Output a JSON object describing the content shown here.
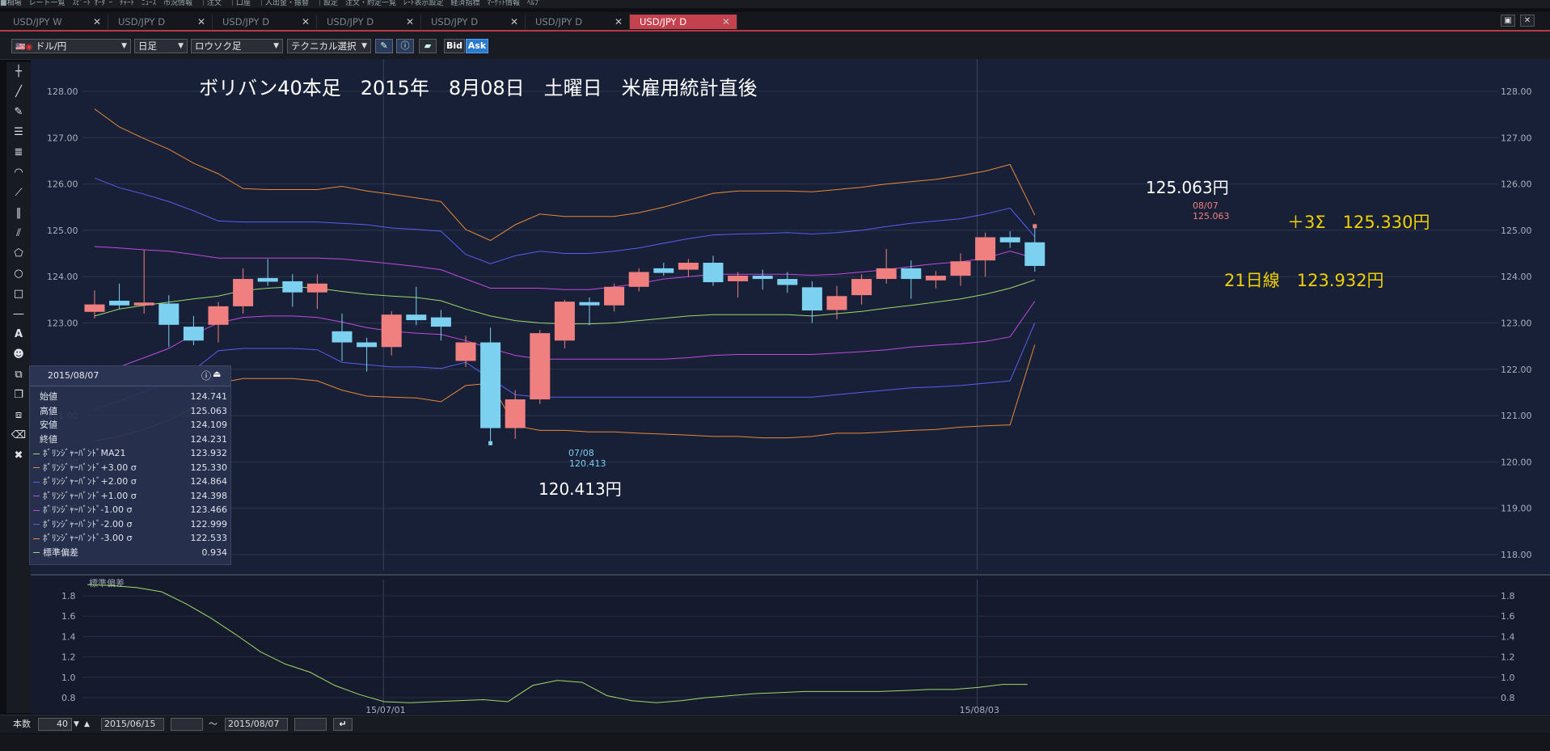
{
  "menubar": {
    "text": "■相場　レート一覧　ｽﾋﾟｰﾄﾞｵｰﾀﾞｰ　ﾁｬｰﾄ　ﾆｭｰｽ　市況情報　｜注文　｜口座　｜入出金・振替　｜設定　注文・約定一覧　ﾚｰﾄ表示設定　経済指標　ﾏｰｹｯﾄ情報　ﾍﾙﾌﾟ"
  },
  "tabs": [
    {
      "label": "USD/JPY W",
      "active": false
    },
    {
      "label": "USD/JPY D",
      "active": false
    },
    {
      "label": "USD/JPY D",
      "active": false
    },
    {
      "label": "USD/JPY D",
      "active": false
    },
    {
      "label": "USD/JPY D",
      "active": false
    },
    {
      "label": "USD/JPY D",
      "active": false
    },
    {
      "label": "USD/JPY D",
      "active": true
    }
  ],
  "toolbar": {
    "pair": "ドル/円",
    "period": "日足",
    "chart_type": "ロウソク足",
    "technical": "テクニカル選択",
    "bid": "Bid",
    "ask": "Ask"
  },
  "tools": [
    "crosshair",
    "line",
    "ruler",
    "hlines",
    "channels",
    "arc",
    "fan",
    "vlines",
    "gann",
    "pentagon",
    "circle",
    "rect",
    "dash",
    "text",
    "label",
    "copy-a",
    "copy-b",
    "copy-c",
    "eraser",
    "eraser-b"
  ],
  "annotations": {
    "title": "ボリバン40本足　2015年　8月08日　土曜日　米雇用統計直後",
    "high_label": "125.063円",
    "high_tag_date": "08/07",
    "high_tag_value": "125.063",
    "plus3sigma": "＋3Σ　125.330円",
    "ma21": "21日線　123.932円",
    "low_label": "120.413円",
    "low_tag_date": "07/08",
    "low_tag_value": "120.413"
  },
  "info_panel": {
    "date": "2015/08/07",
    "rows": [
      {
        "label": "始値",
        "value": "124.741",
        "color": ""
      },
      {
        "label": "高値",
        "value": "125.063",
        "color": ""
      },
      {
        "label": "安値",
        "value": "124.109",
        "color": ""
      },
      {
        "label": "終値",
        "value": "124.231",
        "color": ""
      },
      {
        "label": "ﾎﾞﾘﾝｼﾞｬｰﾊﾞﾝﾄﾞMA21",
        "value": "123.932",
        "color": "#9fd96a"
      },
      {
        "label": "ﾎﾞﾘﾝｼﾞｬｰﾊﾞﾝﾄﾞ+3.00 σ",
        "value": "125.330",
        "color": "#e8893a"
      },
      {
        "label": "ﾎﾞﾘﾝｼﾞｬｰﾊﾞﾝﾄﾞ+2.00 σ",
        "value": "124.864",
        "color": "#5a5ef0"
      },
      {
        "label": "ﾎﾞﾘﾝｼﾞｬｰﾊﾞﾝﾄﾞ+1.00 σ",
        "value": "124.398",
        "color": "#c04ae0"
      },
      {
        "label": "ﾎﾞﾘﾝｼﾞｬｰﾊﾞﾝﾄﾞ-1.00 σ",
        "value": "123.466",
        "color": "#c04ae0"
      },
      {
        "label": "ﾎﾞﾘﾝｼﾞｬｰﾊﾞﾝﾄﾞ-2.00 σ",
        "value": "122.999",
        "color": "#5a5ef0"
      },
      {
        "label": "ﾎﾞﾘﾝｼﾞｬｰﾊﾞﾝﾄﾞ-3.00 σ",
        "value": "122.533",
        "color": "#e8893a"
      },
      {
        "label": "標準偏差",
        "value": "0.934",
        "color": "#9fd96a"
      }
    ]
  },
  "bottom": {
    "count_label": "本数",
    "count_value": "40",
    "from_date": "2015/06/15",
    "tilde": "～",
    "to_date": "2015/08/07"
  },
  "colors": {
    "up": "#f08080",
    "down": "#7cd0f0",
    "ma": "#9fd96a",
    "s1": "#c04ae0",
    "s2": "#5a5ef0",
    "s3": "#e8893a",
    "annotation": "#f0d000"
  },
  "chart_data": [
    {
      "type": "candlestick",
      "ylim": [
        117.7,
        128.4
      ],
      "yticks": [
        "128.00",
        "127.00",
        "126.00",
        "125.00",
        "124.00",
        "123.00",
        "122.00",
        "121.00",
        "120.00",
        "119.00",
        "118.00"
      ],
      "x_tick_labels": [
        {
          "label": "15/07/01",
          "index": 12
        },
        {
          "label": "15/08/03",
          "index": 36
        }
      ],
      "candles": [
        {
          "o": 123.24,
          "h": 123.7,
          "l": 123.1,
          "c": 123.4
        },
        {
          "o": 123.48,
          "h": 123.85,
          "l": 123.3,
          "c": 123.38
        },
        {
          "o": 123.38,
          "h": 124.58,
          "l": 123.2,
          "c": 123.44
        },
        {
          "o": 123.42,
          "h": 123.6,
          "l": 122.48,
          "c": 122.96
        },
        {
          "o": 122.92,
          "h": 123.15,
          "l": 122.52,
          "c": 122.62
        },
        {
          "o": 122.96,
          "h": 123.45,
          "l": 122.58,
          "c": 123.36
        },
        {
          "o": 123.36,
          "h": 124.18,
          "l": 123.2,
          "c": 123.95
        },
        {
          "o": 123.97,
          "h": 124.38,
          "l": 123.8,
          "c": 123.89
        },
        {
          "o": 123.9,
          "h": 124.05,
          "l": 123.35,
          "c": 123.66
        },
        {
          "o": 123.66,
          "h": 124.05,
          "l": 123.3,
          "c": 123.85
        },
        {
          "o": 122.82,
          "h": 123.2,
          "l": 122.18,
          "c": 122.58
        },
        {
          "o": 122.58,
          "h": 122.68,
          "l": 121.95,
          "c": 122.48
        },
        {
          "o": 122.48,
          "h": 123.25,
          "l": 122.3,
          "c": 123.18
        },
        {
          "o": 123.18,
          "h": 123.78,
          "l": 122.95,
          "c": 123.06
        },
        {
          "o": 123.12,
          "h": 123.28,
          "l": 122.62,
          "c": 122.92
        },
        {
          "o": 122.18,
          "h": 122.72,
          "l": 122.05,
          "c": 122.58
        },
        {
          "o": 122.58,
          "h": 122.9,
          "l": 120.413,
          "c": 120.73
        },
        {
          "o": 120.73,
          "h": 121.55,
          "l": 120.5,
          "c": 121.35
        },
        {
          "o": 121.35,
          "h": 122.85,
          "l": 121.25,
          "c": 122.78
        },
        {
          "o": 122.62,
          "h": 123.5,
          "l": 122.45,
          "c": 123.46
        },
        {
          "o": 123.45,
          "h": 123.55,
          "l": 122.95,
          "c": 123.38
        },
        {
          "o": 123.38,
          "h": 123.85,
          "l": 123.25,
          "c": 123.78
        },
        {
          "o": 123.78,
          "h": 124.18,
          "l": 123.68,
          "c": 124.1
        },
        {
          "o": 124.18,
          "h": 124.3,
          "l": 124.02,
          "c": 124.08
        },
        {
          "o": 124.15,
          "h": 124.38,
          "l": 124.0,
          "c": 124.3
        },
        {
          "o": 124.3,
          "h": 124.45,
          "l": 123.8,
          "c": 123.88
        },
        {
          "o": 123.9,
          "h": 124.1,
          "l": 123.55,
          "c": 124.02
        },
        {
          "o": 124.02,
          "h": 124.15,
          "l": 123.72,
          "c": 123.95
        },
        {
          "o": 123.95,
          "h": 124.1,
          "l": 123.65,
          "c": 123.82
        },
        {
          "o": 123.77,
          "h": 123.9,
          "l": 123.0,
          "c": 123.27
        },
        {
          "o": 123.28,
          "h": 123.8,
          "l": 123.08,
          "c": 123.58
        },
        {
          "o": 123.6,
          "h": 124.05,
          "l": 123.4,
          "c": 123.95
        },
        {
          "o": 123.95,
          "h": 124.6,
          "l": 123.85,
          "c": 124.18
        },
        {
          "o": 124.18,
          "h": 124.35,
          "l": 123.52,
          "c": 123.95
        },
        {
          "o": 123.92,
          "h": 124.12,
          "l": 123.75,
          "c": 124.02
        },
        {
          "o": 124.02,
          "h": 124.5,
          "l": 123.8,
          "c": 124.33
        },
        {
          "o": 124.35,
          "h": 124.95,
          "l": 124.0,
          "c": 124.85
        },
        {
          "o": 124.85,
          "h": 124.98,
          "l": 124.62,
          "c": 124.74
        },
        {
          "o": 124.741,
          "h": 125.063,
          "l": 124.109,
          "c": 124.231
        }
      ],
      "series": [
        {
          "name": "ﾎﾞﾘﾝｼﾞｬｰﾊﾞﾝﾄﾞ+3.00 σ",
          "values": [
            127.62,
            127.23,
            126.98,
            126.75,
            126.45,
            126.22,
            125.9,
            125.88,
            125.88,
            125.88,
            125.95,
            125.85,
            125.78,
            125.7,
            125.62,
            125.02,
            124.78,
            125.12,
            125.35,
            125.3,
            125.3,
            125.3,
            125.38,
            125.5,
            125.65,
            125.8,
            125.85,
            125.85,
            125.85,
            125.83,
            125.88,
            125.93,
            126.0,
            126.05,
            126.1,
            126.18,
            126.28,
            126.42,
            125.33
          ]
        },
        {
          "name": "ﾎﾞﾘﾝｼﾞｬｰﾊﾞﾝﾄﾞ+2.00 σ",
          "values": [
            126.13,
            125.92,
            125.78,
            125.62,
            125.42,
            125.2,
            125.18,
            125.18,
            125.18,
            125.18,
            125.15,
            125.12,
            125.05,
            125.02,
            124.98,
            124.48,
            124.28,
            124.45,
            124.55,
            124.5,
            124.5,
            124.55,
            124.62,
            124.72,
            124.82,
            124.9,
            124.92,
            124.93,
            124.95,
            124.92,
            124.95,
            125.0,
            125.08,
            125.15,
            125.2,
            125.25,
            125.35,
            125.48,
            124.86
          ]
        },
        {
          "name": "ﾎﾞﾘﾝｼﾞｬｰﾊﾞﾝﾄﾞ+1.00 σ",
          "values": [
            124.65,
            124.62,
            124.58,
            124.55,
            124.48,
            124.4,
            124.4,
            124.4,
            124.4,
            124.4,
            124.38,
            124.33,
            124.28,
            124.22,
            124.15,
            123.95,
            123.75,
            123.75,
            123.75,
            123.72,
            123.72,
            123.78,
            123.85,
            123.95,
            124.0,
            124.05,
            124.05,
            124.05,
            124.05,
            124.03,
            124.05,
            124.1,
            124.15,
            124.22,
            124.28,
            124.32,
            124.4,
            124.55,
            124.4
          ]
        },
        {
          "name": "ﾎﾞﾘﾝｼﾞｬｰﾊﾞﾝﾄﾞMA21",
          "values": [
            123.15,
            123.3,
            123.38,
            123.45,
            123.52,
            123.58,
            123.7,
            123.75,
            123.78,
            123.75,
            123.68,
            123.62,
            123.58,
            123.55,
            123.48,
            123.3,
            123.15,
            123.05,
            123.0,
            122.98,
            122.98,
            123.0,
            123.05,
            123.1,
            123.15,
            123.18,
            123.18,
            123.18,
            123.18,
            123.15,
            123.2,
            123.25,
            123.32,
            123.38,
            123.45,
            123.52,
            123.62,
            123.75,
            123.93
          ]
        },
        {
          "name": "ﾎﾞﾘﾝｼﾞｬｰﾊﾞﾝﾄﾞ-1.00 σ",
          "values": [
            121.85,
            122.05,
            122.25,
            122.45,
            122.75,
            123.0,
            123.12,
            123.15,
            123.15,
            123.12,
            123.02,
            122.9,
            122.82,
            122.78,
            122.75,
            122.62,
            122.45,
            122.3,
            122.22,
            122.22,
            122.22,
            122.22,
            122.22,
            122.22,
            122.25,
            122.3,
            122.32,
            122.32,
            122.32,
            122.32,
            122.35,
            122.38,
            122.42,
            122.48,
            122.52,
            122.55,
            122.6,
            122.7,
            123.47
          ]
        },
        {
          "name": "ﾎﾞﾘﾝｼﾞｬｰﾊﾞﾝﾄﾞ-2.00 σ",
          "values": [
            121.15,
            121.32,
            121.52,
            121.72,
            121.98,
            122.4,
            122.45,
            122.45,
            122.45,
            122.42,
            122.15,
            122.1,
            122.05,
            122.05,
            122.02,
            122.15,
            121.8,
            121.45,
            121.4,
            121.4,
            121.4,
            121.4,
            121.4,
            121.4,
            121.4,
            121.4,
            121.4,
            121.4,
            121.4,
            121.4,
            121.45,
            121.5,
            121.55,
            121.6,
            121.62,
            121.65,
            121.7,
            121.75,
            123.0
          ]
        },
        {
          "name": "ﾎﾞﾘﾝｼﾞｬｰﾊﾞﾝﾄﾞ-3.00 σ",
          "values": [
            120.45,
            120.55,
            120.7,
            120.9,
            121.18,
            121.7,
            121.8,
            121.8,
            121.8,
            121.75,
            121.55,
            121.42,
            121.4,
            121.38,
            121.3,
            121.65,
            121.7,
            120.78,
            120.68,
            120.68,
            120.65,
            120.65,
            120.62,
            120.6,
            120.58,
            120.55,
            120.55,
            120.52,
            120.52,
            120.55,
            120.62,
            120.62,
            120.65,
            120.68,
            120.7,
            120.75,
            120.78,
            120.8,
            122.53
          ]
        }
      ]
    },
    {
      "type": "line",
      "title": "標準偏差",
      "ylim": [
        0.72,
        1.9
      ],
      "yticks": [
        "1.8",
        "1.6",
        "1.4",
        "1.2",
        "1.0",
        "0.8"
      ],
      "series": [
        {
          "name": "標準偏差",
          "values": [
            1.91,
            1.9,
            1.88,
            1.84,
            1.72,
            1.58,
            1.42,
            1.25,
            1.13,
            1.05,
            0.92,
            0.83,
            0.76,
            0.75,
            0.76,
            0.77,
            0.78,
            0.76,
            0.92,
            0.97,
            0.95,
            0.82,
            0.77,
            0.75,
            0.77,
            0.8,
            0.82,
            0.84,
            0.85,
            0.86,
            0.86,
            0.86,
            0.86,
            0.87,
            0.88,
            0.88,
            0.9,
            0.93,
            0.93
          ]
        }
      ]
    }
  ]
}
